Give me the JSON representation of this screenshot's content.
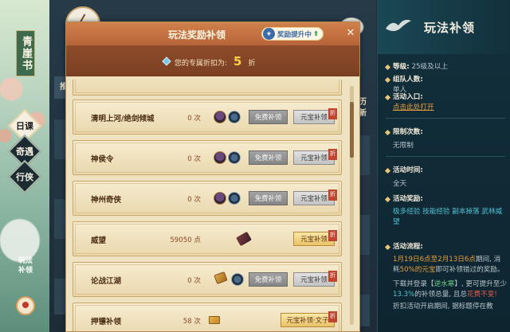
{
  "left_nav": {
    "banner_title": "青崖书",
    "items": [
      {
        "label": "日课",
        "active": true
      },
      {
        "label": "奇遇",
        "active": false
      },
      {
        "label": "行侠",
        "active": false
      }
    ],
    "bottom_tab": "玩法补领"
  },
  "background": {
    "tab_left": "推",
    "tab_right": "历新"
  },
  "modal": {
    "title": "玩法奖励补领",
    "boost_badge": "奖励提升中",
    "boost_badge_icon": "boost-icon",
    "discount_prefix": "您的专属折扣为:",
    "discount_value": "5",
    "discount_suffix": "折",
    "close_icon": "close-icon",
    "rows": [
      {
        "name": "",
        "count": "",
        "free_label": "",
        "yb_label": "",
        "partial": true
      },
      {
        "name": "清明上河/绝剑倾城",
        "count": "0 次",
        "free_label": "免费补领",
        "yb_label": "元宝补领",
        "tag": "折",
        "icons": [
          "reward-icon-a",
          "reward-icon-b"
        ]
      },
      {
        "name": "神侯令",
        "count": "0 次",
        "free_label": "免费补领",
        "yb_label": "元宝补领",
        "tag": "折",
        "icons": [
          "reward-icon-a",
          "reward-icon-b"
        ]
      },
      {
        "name": "神州奇侠",
        "count": "0 次",
        "free_label": "免费补领",
        "yb_label": "元宝补领",
        "tag": "折",
        "icons": [
          "reward-icon-a",
          "reward-icon-b"
        ]
      },
      {
        "name": "威望",
        "count": "59050 点",
        "free_label": "",
        "yb_label": "元宝补领",
        "tag": "折",
        "icons": [
          "weapon-icon"
        ]
      },
      {
        "name": "论战江湖",
        "count": "0 次",
        "free_label": "免费补领",
        "yb_label": "元宝补领",
        "tag": "折",
        "icons": [
          "scroll-icon",
          "reward-icon-b"
        ]
      },
      {
        "name": "押镖补领",
        "count": "58 次",
        "free_label": "",
        "yb_label": "元宝补领·文子",
        "tag": "折",
        "icons": [
          "gold-icon"
        ]
      }
    ]
  },
  "info_panel": {
    "title": "玩法补领",
    "level_label": "等级:",
    "level_value": "25级及以上",
    "team_label": "组队人数:",
    "team_value": "单人",
    "entry_label": "活动入口:",
    "entry_link": "点击此处打开",
    "limit_label": "限制次数:",
    "limit_value": "无限制",
    "time_label": "活动时间:",
    "time_value": "全天",
    "reward_label": "活动奖励:",
    "reward_items": [
      "极多经验",
      "技能经验",
      "副本掉落",
      "武林威望"
    ],
    "flow_label": "活动流程:",
    "flow_p1_a": "1月19日6点至2月13日6点",
    "flow_p1_b": "期间, 消耗",
    "flow_p1_c": "50%的元宝",
    "flow_p1_d": "即可补领错过的奖励。",
    "flow_p2_a": "下载并登录【",
    "flow_p2_link": "逆水寒",
    "flow_p2_b": "】, 更可提升至少",
    "flow_p2_c": "13.3%",
    "flow_p2_d": "的补领总量, 且总",
    "flow_p2_e": "花费不变!",
    "flow_p3": "折扣活动开启期间, 据标题停在教"
  }
}
